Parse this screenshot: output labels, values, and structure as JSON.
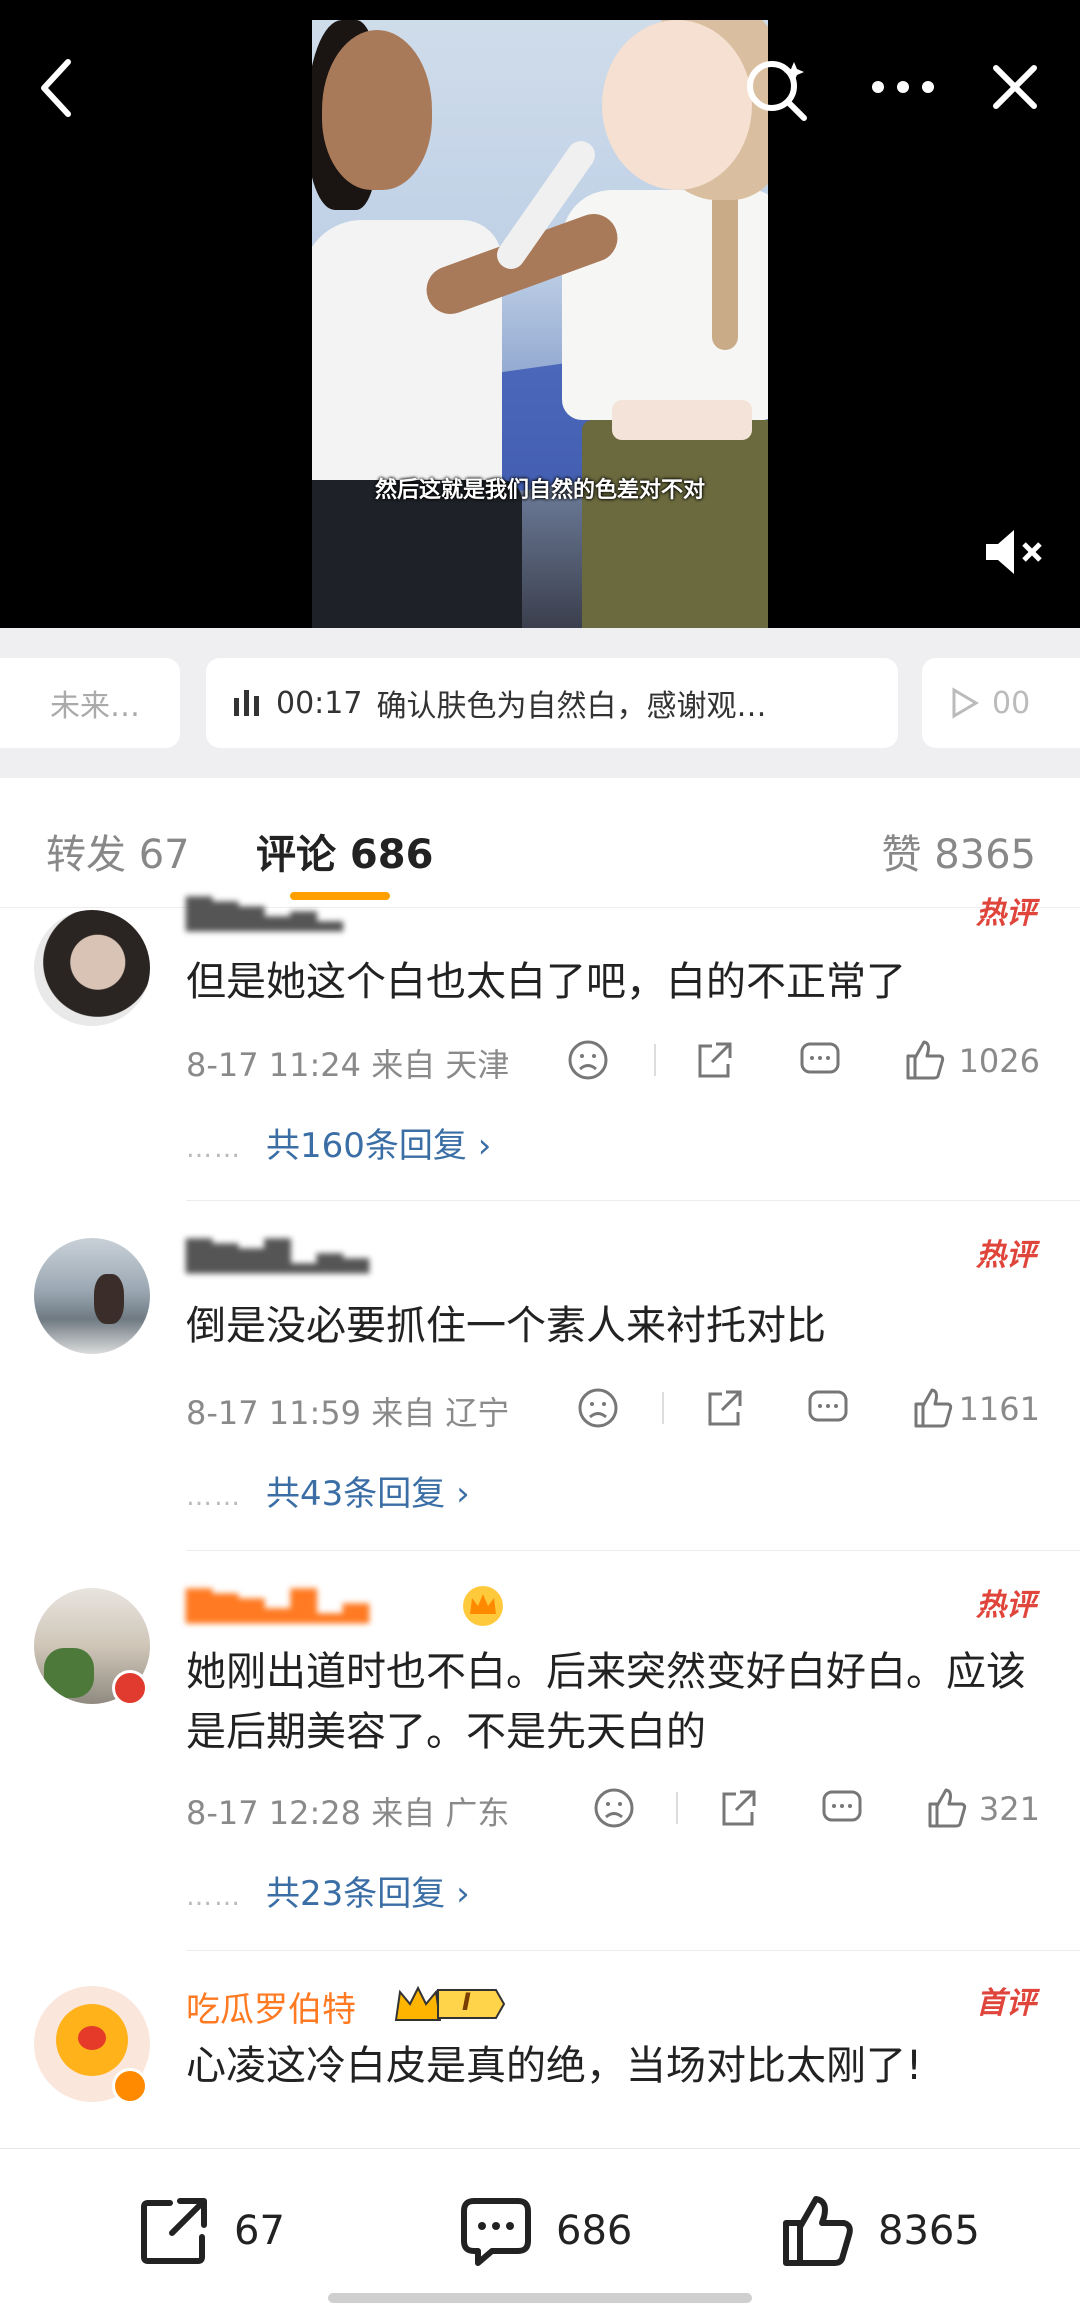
{
  "video": {
    "subtitle": "然后这就是我们自然的色差对不对"
  },
  "segments": {
    "prev_text": "未来…",
    "current_time": "00:17",
    "current_text": "确认肤色为自然白，感谢观…",
    "next_time": "00"
  },
  "tabs": {
    "repost": "转发 67",
    "comments": "评论 686",
    "likes": "赞 8365"
  },
  "comments": [
    {
      "username": "▇▆▅▃▄▂",
      "badge": "热评",
      "text": "但是她这个白也太白了吧，白的不正常了",
      "time": "8-17 11:24",
      "location": "来自 天津",
      "likes": "1026",
      "replies": "共160条回复 ›"
    },
    {
      "username": "▇▆▅▇▂▄▃",
      "badge": "热评",
      "text": "倒是没必要抓住一个素人来衬托对比",
      "time": "8-17 11:59",
      "location": "来自 辽宁",
      "likes": "1161",
      "replies": "共43条回复 ›"
    },
    {
      "username": "▇▆▅▃▇▂▄",
      "badge": "热评",
      "text": "她刚出道时也不白。后来突然变好白好白。应该是后期美容了。不是先天白的",
      "time": "8-17 12:28",
      "location": "来自 广东",
      "likes": "321",
      "replies": "共23条回复 ›"
    },
    {
      "username": "吃瓜罗伯特",
      "badge": "首评",
      "level": "I",
      "text": "心凌这冷白皮是真的绝，当场对比太刚了!",
      "time": "",
      "location": "",
      "likes": "",
      "replies": ""
    }
  ],
  "reply_dots": "……",
  "bottom_bar": {
    "repost": "67",
    "comment": "686",
    "like": "8365"
  },
  "colors": {
    "accent": "#ffa000",
    "username": "#ff7a22",
    "hot_badge": "#e0453c",
    "reply_link": "#3a6ea5"
  }
}
